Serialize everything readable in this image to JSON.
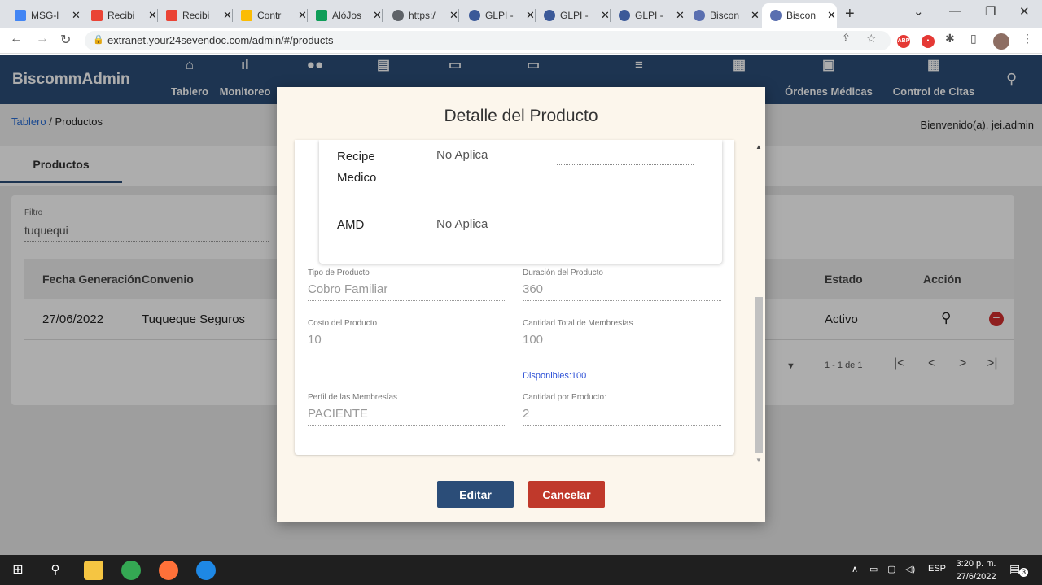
{
  "browser": {
    "tabs": [
      {
        "title": "MSG-l",
        "icon": "docs-icon",
        "color": "#4285f4"
      },
      {
        "title": "Recibi",
        "icon": "gmail-icon",
        "color": "#ea4335"
      },
      {
        "title": "Recibi",
        "icon": "gmail-icon",
        "color": "#ea4335"
      },
      {
        "title": "Contr",
        "icon": "drive-icon",
        "color": "#fbbc04"
      },
      {
        "title": "AlóJos",
        "icon": "sheets-icon",
        "color": "#0f9d58"
      },
      {
        "title": "https:/",
        "icon": "globe-icon",
        "color": "#5f6368"
      },
      {
        "title": "GLPI -",
        "icon": "glpi-icon",
        "color": "#3b5998"
      },
      {
        "title": "GLPI -",
        "icon": "glpi-icon",
        "color": "#3b5998"
      },
      {
        "title": "GLPI -",
        "icon": "glpi-icon",
        "color": "#3b5998"
      },
      {
        "title": "Biscon",
        "icon": "biscomm-icon",
        "color": "#5a6fb0"
      },
      {
        "title": "Biscon",
        "icon": "biscomm-icon",
        "color": "#5a6fb0"
      }
    ],
    "url": "extranet.your24sevendoc.com/admin/#/products"
  },
  "app": {
    "brand": "BiscommAdmin",
    "nav": [
      {
        "label": "Tablero",
        "icon": "home-icon",
        "glyph": "⌂"
      },
      {
        "label": "Monitoreo",
        "icon": "bar-chart-icon",
        "glyph": "▮"
      },
      {
        "label": "",
        "icon": "people-icon",
        "glyph": "👥"
      },
      {
        "label": "",
        "icon": "store-icon",
        "glyph": "▤"
      },
      {
        "label": "",
        "icon": "card-icon",
        "glyph": "▭"
      },
      {
        "label": "",
        "icon": "card-icon",
        "glyph": "▭"
      },
      {
        "label": "",
        "icon": "list-icon",
        "glyph": "≡"
      },
      {
        "label": "",
        "icon": "calendar-icon",
        "glyph": "▦"
      },
      {
        "label": "Órdenes Médicas",
        "icon": "clipboard-icon",
        "glyph": "▣"
      },
      {
        "label": "Control de Citas",
        "icon": "calendar-icon",
        "glyph": "▦"
      }
    ],
    "breadcrumb_link": "Tablero",
    "breadcrumb_current": " / Productos",
    "welcome": "Bienvenido(a), jei.admin",
    "subtab": "Productos"
  },
  "list": {
    "filter_label": "Filtro",
    "filter_value": "tuquequi",
    "headers": {
      "fecha": "Fecha Generación",
      "convenio": "Convenio",
      "estado": "Estado",
      "accion": "Acción"
    },
    "row": {
      "fecha": "27/06/2022",
      "convenio": "Tuqueque Seguros",
      "estado": "Activo"
    },
    "pager_range": "1 - 1 de 1"
  },
  "modal": {
    "title": "Detalle del Producto",
    "recipe_label_1": "Recipe",
    "recipe_label_2": "Medico",
    "recipe_value": "No Aplica",
    "amd_label": "AMD",
    "amd_value": "No Aplica",
    "fields": {
      "tipo_label": "Tipo de Producto",
      "tipo_value": "Cobro Familiar",
      "duracion_label": "Duración del Producto",
      "duracion_value": "360",
      "costo_label": "Costo del Producto",
      "costo_value": "10",
      "cantidad_total_label": "Cantidad Total de Membresías",
      "cantidad_total_value": "100",
      "disponibles": "Disponibles:100",
      "perfil_label": "Perfil de las Membresías",
      "perfil_value": "PACIENTE",
      "cantidad_producto_label": "Cantidad por Producto:",
      "cantidad_producto_value": "2"
    },
    "edit_button": "Editar",
    "cancel_button": "Cancelar"
  },
  "taskbar": {
    "language": "ESP",
    "time": "3:20 p. m.",
    "date": "27/6/2022",
    "notifications": "3"
  },
  "colors": {
    "header": "#2b4d78",
    "edit": "#2b4d78",
    "cancel": "#c0392b",
    "link": "#2b6fd6"
  }
}
